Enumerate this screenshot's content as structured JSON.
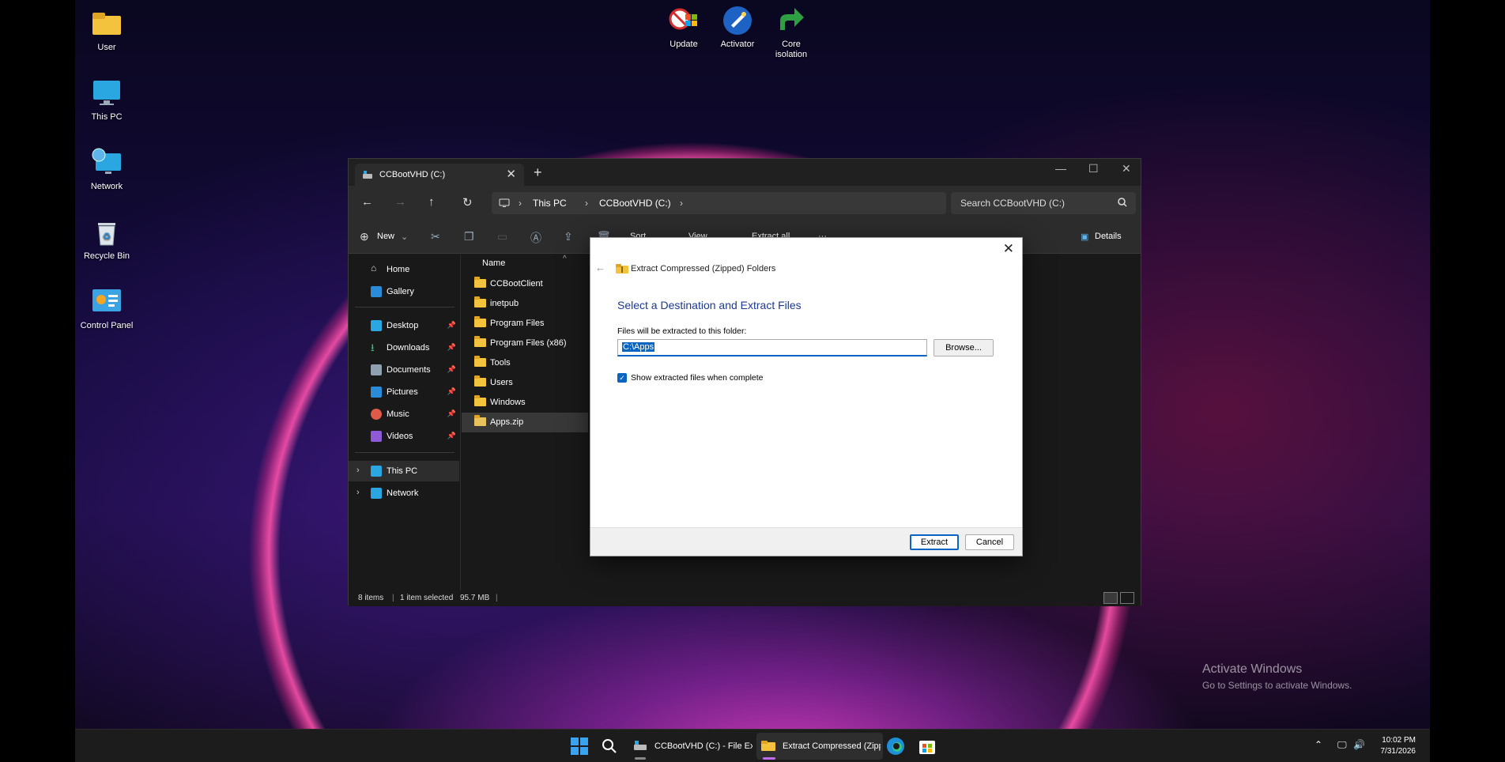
{
  "desktop": {
    "icons": [
      {
        "label": "User"
      },
      {
        "label": "This PC"
      },
      {
        "label": "Network"
      },
      {
        "label": "Recycle Bin"
      },
      {
        "label": "Control Panel"
      },
      {
        "label": "Update"
      },
      {
        "label": "Activator"
      },
      {
        "label": "Core isolation"
      }
    ]
  },
  "explorer": {
    "tab_title": "CCBootVHD (C:)",
    "breadcrumb": [
      "This PC",
      "CCBootVHD (C:)"
    ],
    "search_placeholder": "Search CCBootVHD (C:)",
    "commands": {
      "new": "New",
      "sort": "Sort",
      "view": "View",
      "extract_all": "Extract all",
      "details": "Details"
    },
    "nav": {
      "home": "Home",
      "gallery": "Gallery",
      "pinned": [
        "Desktop",
        "Downloads",
        "Documents",
        "Pictures",
        "Music",
        "Videos"
      ],
      "this_pc": "This PC",
      "network": "Network"
    },
    "column_name": "Name",
    "files": [
      "CCBootClient",
      "inetpub",
      "Program Files",
      "Program Files (x86)",
      "Tools",
      "Users",
      "Windows",
      "Apps.zip"
    ],
    "selected_file": "Apps.zip",
    "status": {
      "items": "8 items",
      "selection": "1 item selected",
      "size": "95.7 MB"
    }
  },
  "dialog": {
    "caption": "Extract Compressed (Zipped) Folders",
    "heading": "Select a Destination and Extract Files",
    "path_label": "Files will be extracted to this folder:",
    "path_value": "C:\\Apps",
    "browse": "Browse...",
    "checkbox_label": "Show extracted files when complete",
    "checkbox_checked": true,
    "extract": "Extract",
    "cancel": "Cancel"
  },
  "watermark": {
    "title": "Activate Windows",
    "subtitle": "Go to Settings to activate Windows."
  },
  "taskbar": {
    "explorer_label": "CCBootVHD (C:) - File Explorer",
    "extract_label": "Extract Compressed (Zipped) Folders",
    "time": "10:02 PM",
    "date": "7/31/2026"
  },
  "colors": {
    "accent": "#0a64c2",
    "heading": "#1b3a90",
    "folder": "#f3c33e"
  }
}
